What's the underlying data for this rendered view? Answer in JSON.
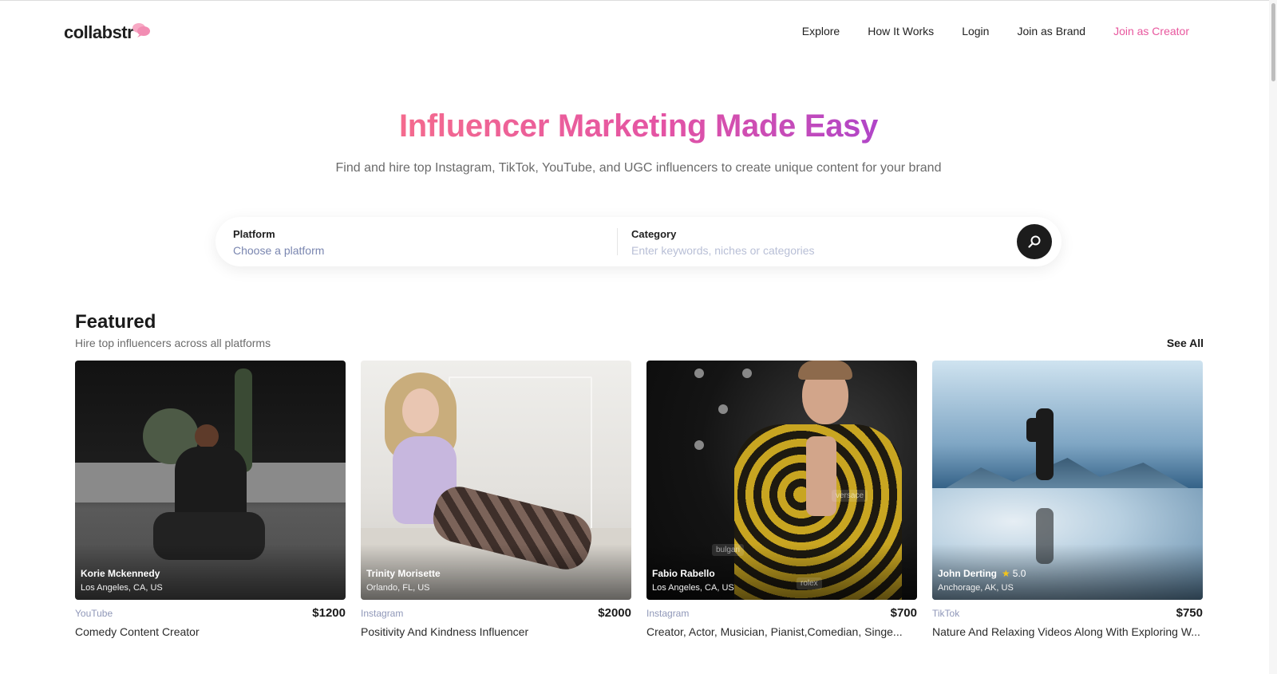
{
  "brand": {
    "logo_text": "collabstr"
  },
  "nav": {
    "explore": "Explore",
    "how_it_works": "How It Works",
    "login": "Login",
    "join_brand": "Join as Brand",
    "join_creator": "Join as Creator"
  },
  "hero": {
    "title": "Influencer Marketing Made Easy",
    "subtitle": "Find and hire top Instagram, TikTok, YouTube, and UGC influencers to create unique content for your brand"
  },
  "search": {
    "platform_label": "Platform",
    "platform_placeholder": "Choose a platform",
    "category_label": "Category",
    "category_placeholder": "Enter keywords, niches or categories"
  },
  "featured": {
    "title": "Featured",
    "subtitle": "Hire top influencers across all platforms",
    "see_all": "See All",
    "cards": [
      {
        "name": "Korie Mckennedy",
        "location": "Los Angeles, CA, US",
        "platform": "YouTube",
        "price": "$1200",
        "description": "Comedy Content Creator"
      },
      {
        "name": "Trinity Morisette",
        "location": "Orlando, FL, US",
        "platform": "Instagram",
        "price": "$2000",
        "description": "Positivity And Kindness Influencer"
      },
      {
        "name": "Fabio Rabello",
        "location": "Los Angeles, CA, US",
        "platform": "Instagram",
        "price": "$700",
        "description": "Creator, Actor, Musician, Pianist,Comedian, Singe...",
        "watermarks": [
          "versace",
          "bulgari",
          "rolex"
        ]
      },
      {
        "name": "John Derting",
        "rating": "5.0",
        "location": "Anchorage, AK, US",
        "platform": "TikTok",
        "price": "$750",
        "description": "Nature And Relaxing Videos Along With Exploring W..."
      }
    ]
  },
  "colors": {
    "accent_pink": "#e8579e",
    "gradient_start": "#f46b8e",
    "gradient_end": "#b045c8",
    "platform_text": "#8f97b8"
  }
}
